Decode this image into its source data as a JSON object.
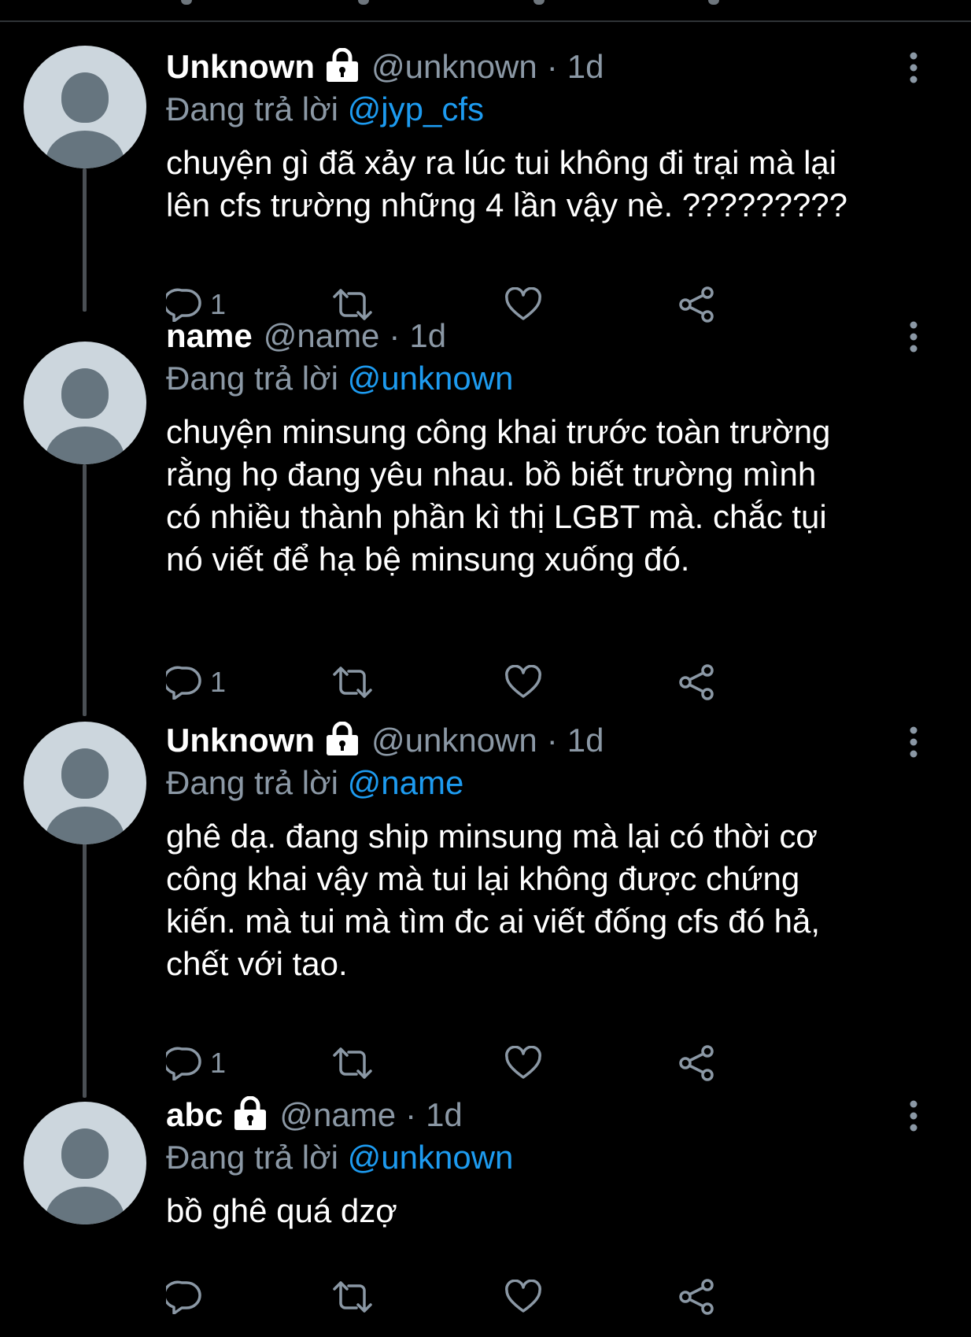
{
  "colors": {
    "background": "#000000",
    "text": "#ffffff",
    "muted": "#8b98a5",
    "link": "#1d9bf0",
    "thread_line": "#4a4f54",
    "avatar_bg": "#ccd6dd",
    "avatar_fg": "#66757f"
  },
  "icons": {
    "lock": "lock-icon",
    "more": "more-vertical-icon",
    "reply": "reply-icon",
    "retweet": "retweet-icon",
    "like": "heart-icon",
    "share": "share-icon"
  },
  "tweets": [
    {
      "display_name": "Unknown",
      "locked": true,
      "handle": "@unknown",
      "separator": "·",
      "time": "1d",
      "reply_prefix": "Đang trả lời",
      "reply_to": "@jyp_cfs",
      "text": "chuyện gì đã xảy ra lúc tui không đi trại mà lại\nlên cfs trường những 4 lần vậy nè. ?????????",
      "reply_count": "1"
    },
    {
      "display_name": "name",
      "locked": false,
      "handle": "@name",
      "separator": "·",
      "time": "1d",
      "reply_prefix": "Đang trả lời",
      "reply_to": "@unknown",
      "text": "chuyện minsung công khai trước toàn trường\nrằng họ đang yêu nhau. bồ biết trường mình\ncó nhiều thành phần kì thị LGBT mà. chắc tụi\nnó viết để hạ bệ minsung xuống đó.",
      "reply_count": "1"
    },
    {
      "display_name": "Unknown",
      "locked": true,
      "handle": "@unknown",
      "separator": "·",
      "time": "1d",
      "reply_prefix": "Đang trả lời",
      "reply_to": "@name",
      "text": "ghê dạ. đang ship minsung mà lại có thời cơ\ncông khai vậy mà tui lại không được chứng\nkiến. mà tui mà tìm đc ai viết đống cfs đó hả,\nchết với tao.",
      "reply_count": "1"
    },
    {
      "display_name": "abc",
      "locked": true,
      "handle": "@name",
      "separator": "·",
      "time": "1d",
      "reply_prefix": "Đang trả lời",
      "reply_to": "@unknown",
      "text": "bồ ghê quá dzợ",
      "reply_count": ""
    }
  ]
}
